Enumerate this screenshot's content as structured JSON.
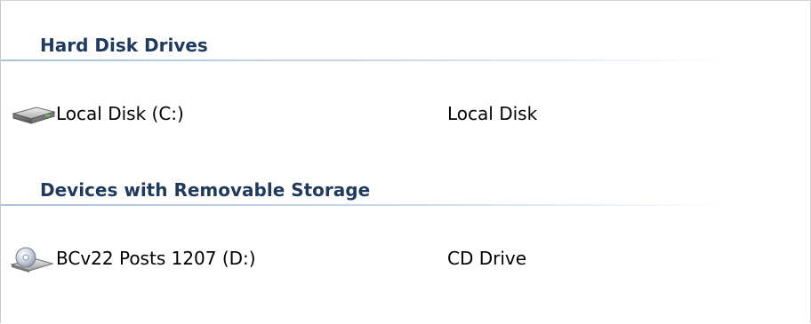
{
  "groups": [
    {
      "title": "Hard Disk Drives",
      "drives": [
        {
          "name": "Local Disk (C:)",
          "type": "Local Disk",
          "icon": "hard-disk-icon"
        }
      ]
    },
    {
      "title": "Devices with Removable Storage",
      "drives": [
        {
          "name": "BCv22 Posts 1207 (D:)",
          "type": "CD Drive",
          "icon": "cd-drive-icon"
        }
      ]
    }
  ]
}
